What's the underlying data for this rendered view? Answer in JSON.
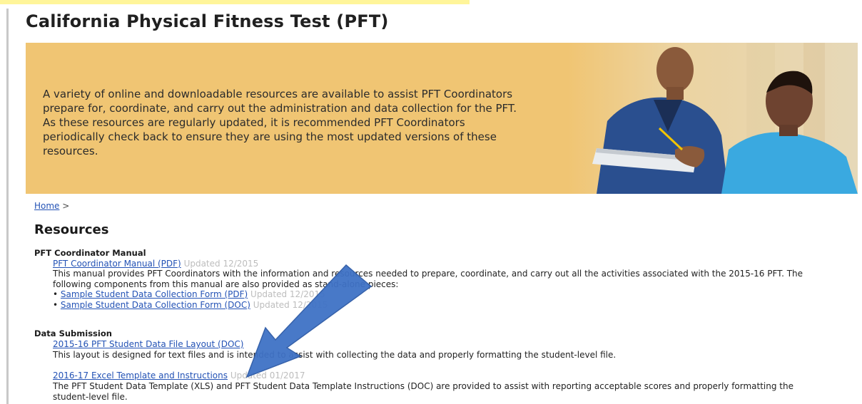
{
  "page_title": "California Physical Fitness Test (PFT)",
  "banner": {
    "text": "A variety of online and downloadable resources are available to assist PFT Coordinators prepare for, coordinate, and carry out the administration and data collection for the PFT. As these resources are regularly updated, it is recommended PFT Coordinators periodically check back to ensure they are using the most updated versions of these resources."
  },
  "breadcrumb": {
    "home": "Home",
    "separator": ">"
  },
  "resources": {
    "title": "Resources",
    "coordinator_manual": {
      "heading": "PFT Coordinator Manual",
      "link": "PFT Coordinator Manual (PDF)",
      "updated": "Updated 12/2015",
      "description": "This manual provides PFT Coordinators with the information and resources needed to prepare, coordinate, and carry out all the activities associated with the 2015-16 PFT. The following components from this manual are also provided as stand-alone pieces:",
      "items": [
        {
          "link": "Sample Student Data Collection Form (PDF)",
          "updated": "Updated 12/2015"
        },
        {
          "link": "Sample Student Data Collection Form (DOC)",
          "updated": "Updated 12/2015"
        }
      ]
    },
    "data_submission": {
      "heading": "Data Submission",
      "file_layout_link": "2015-16 PFT Student Data File Layout (DOC)",
      "file_layout_desc": "This layout is designed for text files and is intended to assist with collecting the data and properly formatting the student-level file.",
      "excel_link": "2016-17 Excel Template and Instructions",
      "excel_updated": "Updated 01/2017",
      "excel_desc": "The PFT Student Data Template (XLS) and PFT Student Data Template Instructions (DOC) are provided to assist with reporting acceptable scores and properly formatting the student-level file."
    }
  },
  "colors": {
    "banner": "#f0c573",
    "link": "#2352b5",
    "arrow": "#3f72c6",
    "highlight": "#fff59a"
  }
}
